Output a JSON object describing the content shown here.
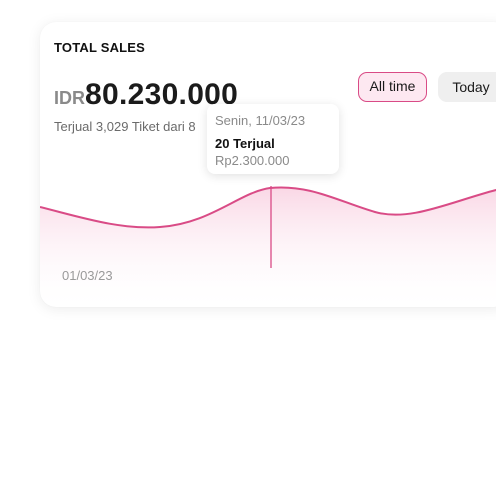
{
  "card": {
    "title": "TOTAL SALES",
    "currency": "IDR",
    "amount": "80.230.000",
    "subtitle": "Terjual 3,029 Tiket dari 8"
  },
  "filters": [
    {
      "label": "All time",
      "active": true
    },
    {
      "label": "Today",
      "active": false
    }
  ],
  "tooltip": {
    "date": "Senin, 11/03/23",
    "sold": "20 Terjual",
    "revenue": "Rp2.300.000"
  },
  "x_axis": {
    "start_label": "01/03/23"
  },
  "colors": {
    "accent": "#d94b86",
    "accent_soft": "#fde8f1"
  }
}
